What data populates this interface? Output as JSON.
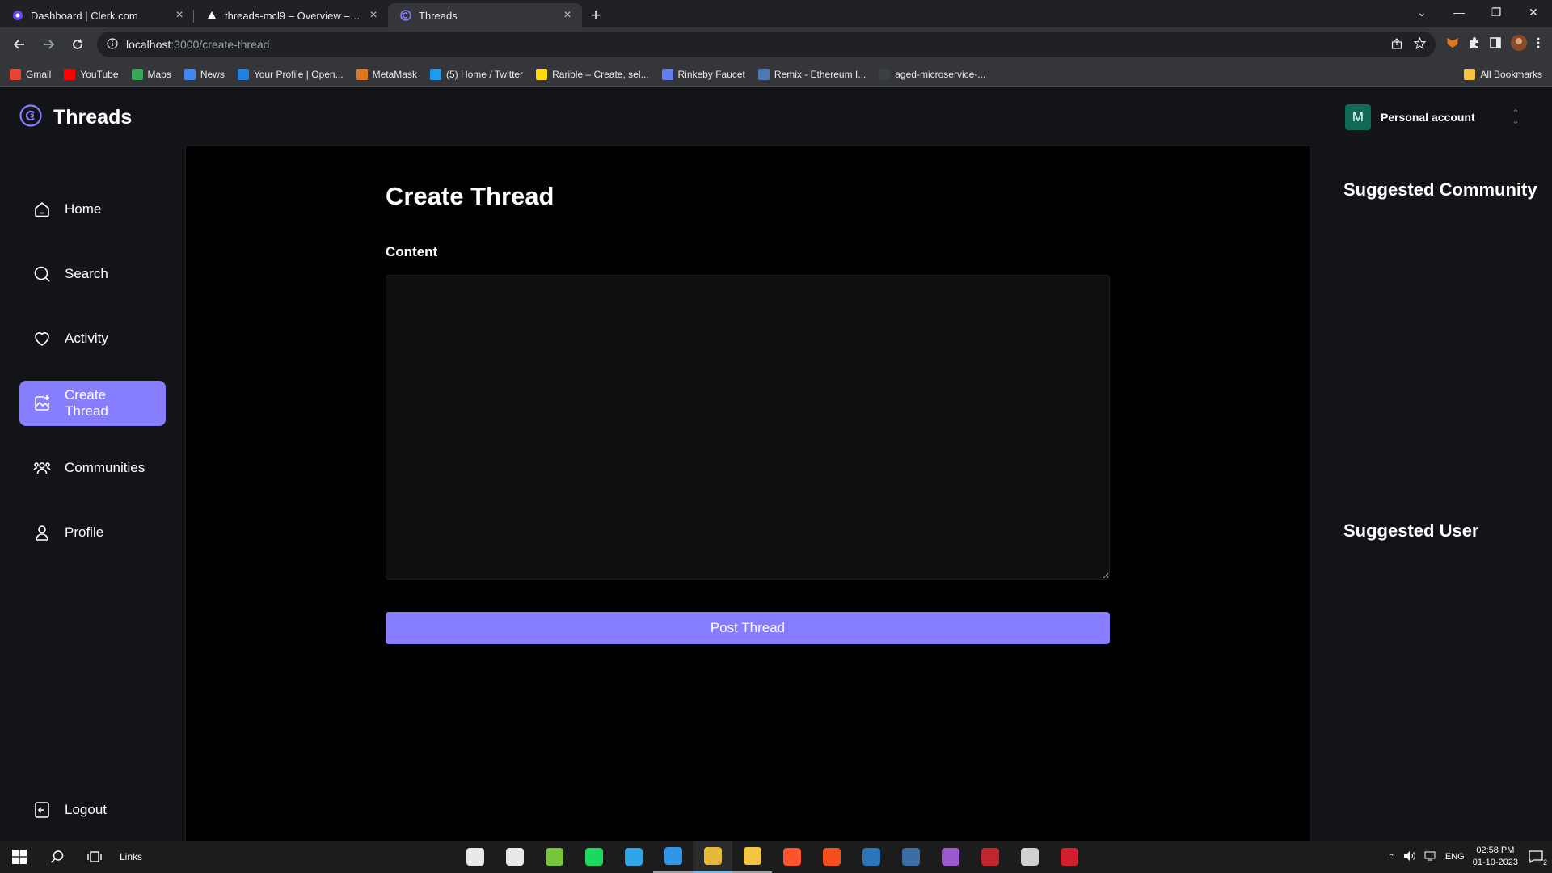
{
  "browser": {
    "tabs": [
      {
        "title": "Dashboard | Clerk.com",
        "active": false
      },
      {
        "title": "threads-mcl9 – Overview – Vercel",
        "active": false
      },
      {
        "title": "Threads",
        "active": true
      }
    ],
    "url_host": "localhost",
    "url_path": ":3000/create-thread",
    "bookmarks": [
      {
        "label": "Gmail",
        "color": "#ea4335"
      },
      {
        "label": "YouTube",
        "color": "#ff0000"
      },
      {
        "label": "Maps",
        "color": "#34a853"
      },
      {
        "label": "News",
        "color": "#4285f4"
      },
      {
        "label": "Your Profile | Open...",
        "color": "#2081e2"
      },
      {
        "label": "MetaMask",
        "color": "#e2761b"
      },
      {
        "label": "(5) Home / Twitter",
        "color": "#1d9bf0"
      },
      {
        "label": "Rarible – Create, sel...",
        "color": "#feda03"
      },
      {
        "label": "Rinkeby Faucet",
        "color": "#627eea"
      },
      {
        "label": "Remix - Ethereum I...",
        "color": "#4b7bb5"
      },
      {
        "label": "aged-microservice-...",
        "color": "#3c4043"
      }
    ],
    "all_bookmarks": "All Bookmarks"
  },
  "app": {
    "logo_text": "Threads",
    "account": {
      "initial": "M",
      "label": "Personal account"
    },
    "nav": {
      "home": "Home",
      "search": "Search",
      "activity": "Activity",
      "create_thread": "Create Thread",
      "communities": "Communities",
      "profile": "Profile",
      "logout": "Logout"
    },
    "main": {
      "title": "Create Thread",
      "content_label": "Content",
      "content_value": "",
      "post_button": "Post Thread"
    },
    "rightbar": {
      "suggested_community": "Suggested Community",
      "suggested_user": "Suggested User"
    },
    "accent_color": "#877eff"
  },
  "taskbar": {
    "links_label": "Links",
    "language": "ENG",
    "time": "02:58 PM",
    "date": "01-10-2023",
    "notification_count": "2",
    "apps": [
      {
        "name": "security-icon",
        "color": "#e8e8e8",
        "state": ""
      },
      {
        "name": "settings-icon",
        "color": "#e8e8e8",
        "state": ""
      },
      {
        "name": "utorrent-icon",
        "color": "#78c43f",
        "state": ""
      },
      {
        "name": "spotify-icon",
        "color": "#1ed760",
        "state": ""
      },
      {
        "name": "edge-icon",
        "color": "#2fa4e7",
        "state": ""
      },
      {
        "name": "vscode-icon",
        "color": "#2f95e9",
        "state": "running"
      },
      {
        "name": "chrome-icon",
        "color": "#e6b93b",
        "state": "active"
      },
      {
        "name": "file-explorer-icon",
        "color": "#f4c542",
        "state": "running"
      },
      {
        "name": "brave-icon",
        "color": "#fb542b",
        "state": ""
      },
      {
        "name": "figma-icon",
        "color": "#f24e1e",
        "state": ""
      },
      {
        "name": "steam-icon",
        "color": "#2a75bb",
        "state": ""
      },
      {
        "name": "visual-studio-icon",
        "color": "#3a6ea5",
        "state": ""
      },
      {
        "name": "github-desktop-icon",
        "color": "#9b59d0",
        "state": ""
      },
      {
        "name": "game-launcher-icon",
        "color": "#c0272d",
        "state": ""
      },
      {
        "name": "snipping-tool-icon",
        "color": "#d0d0d0",
        "state": ""
      },
      {
        "name": "game-icon",
        "color": "#d02030",
        "state": ""
      }
    ]
  }
}
